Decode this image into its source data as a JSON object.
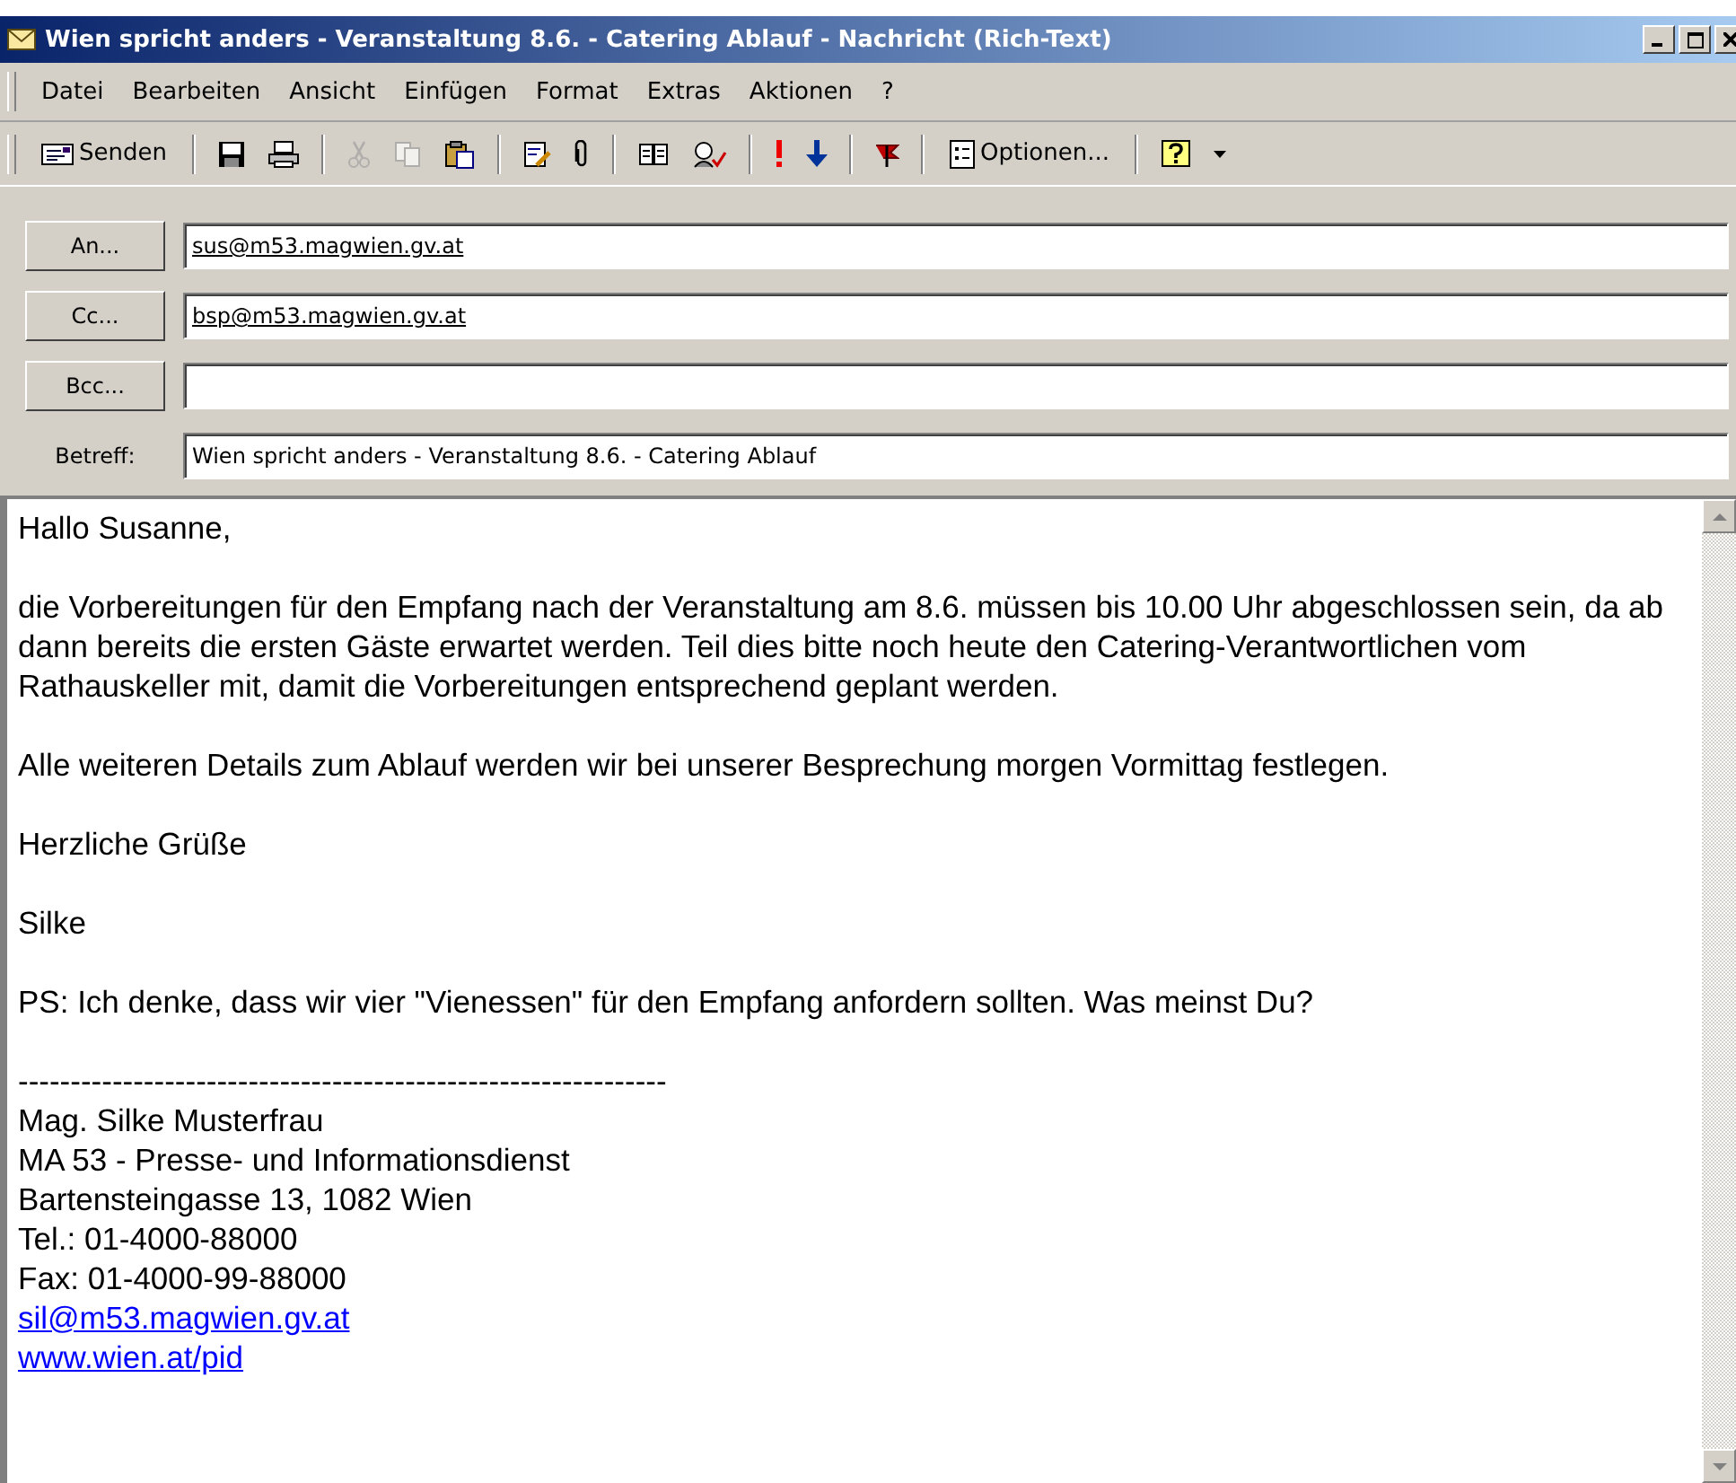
{
  "window": {
    "title": "Wien spricht anders - Veranstaltung 8.6. - Catering Ablauf - Nachricht (Rich-Text)"
  },
  "menu": [
    "Datei",
    "Bearbeiten",
    "Ansicht",
    "Einfügen",
    "Format",
    "Extras",
    "Aktionen",
    "?"
  ],
  "toolbar": {
    "send": {
      "label": "Senden"
    },
    "cut": {
      "disabled": true
    },
    "copy": {
      "disabled": true
    },
    "paste": {
      "disabled": false
    },
    "options": {
      "label": "Optionen..."
    }
  },
  "header_fields": [
    {
      "kind": "recipient",
      "button": "An...",
      "value": "sus@m53.magwien.gv.at"
    },
    {
      "kind": "recipient",
      "button": "Cc...",
      "value": "bsp@m53.magwien.gv.at"
    },
    {
      "kind": "recipient",
      "button": "Bcc..."
    },
    {
      "kind": "subject",
      "label": "Betreff:",
      "value": "Wien spricht anders - Veranstaltung 8.6. - Catering Ablauf"
    }
  ],
  "body": {
    "paragraphs": [
      "Hallo Susanne,",
      "die Vorbereitungen für den Empfang nach der Veranstaltung am 8.6. müssen bis 10.00 Uhr abgeschlossen sein, da ab dann bereits die ersten Gäste erwartet werden. Teil dies bitte noch heute den Catering-Verantwortlichen vom Rathauskeller mit, damit die Vorbereitungen entsprechend geplant werden.",
      "Alle weiteren Details zum Ablauf werden wir bei unserer Besprechung morgen Vormittag festlegen.",
      "Herzliche Grüße",
      "Silke",
      "PS: Ich denke, dass wir vier \"Vienessen\" für den Empfang anfordern sollten. Was meinst Du?"
    ],
    "signature": [
      {
        "kind": "text",
        "text": "--------------------------------------------------------------"
      },
      {
        "kind": "text",
        "text": "Mag. Silke Musterfrau"
      },
      {
        "kind": "text",
        "text": "MA 53 - Presse- und Informationsdienst"
      },
      {
        "kind": "text",
        "text": "Bartensteingasse 13, 1082 Wien"
      },
      {
        "kind": "text",
        "text": "Tel.: 01-4000-88000"
      },
      {
        "kind": "text",
        "text": "Fax: 01-4000-99-88000"
      },
      {
        "kind": "link",
        "text": "sil@m53.magwien.gv.at"
      },
      {
        "kind": "link",
        "text": "www.wien.at/pid"
      }
    ]
  }
}
